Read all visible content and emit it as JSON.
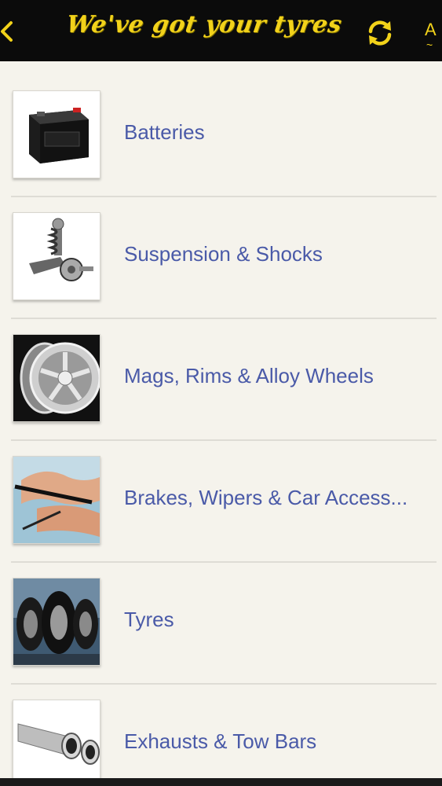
{
  "header": {
    "title": "We've got your tyres",
    "back_icon": "chevron-left-icon",
    "refresh_icon": "refresh-icon",
    "cut_text": "A",
    "accent_color": "#f2d21a",
    "background": "#0b0b0b"
  },
  "categories": [
    {
      "label": "Batteries",
      "icon": "car-battery-image"
    },
    {
      "label": "Suspension & Shocks",
      "icon": "suspension-image"
    },
    {
      "label": "Mags, Rims & Alloy Wheels",
      "icon": "alloy-wheel-image"
    },
    {
      "label": "Brakes, Wipers & Car Access...",
      "icon": "wiper-image"
    },
    {
      "label": "Tyres",
      "icon": "tyres-image"
    },
    {
      "label": "Exhausts & Tow Bars",
      "icon": "exhaust-image"
    }
  ],
  "colors": {
    "label": "#4a5aa8",
    "page_background": "#f5f3ec"
  }
}
